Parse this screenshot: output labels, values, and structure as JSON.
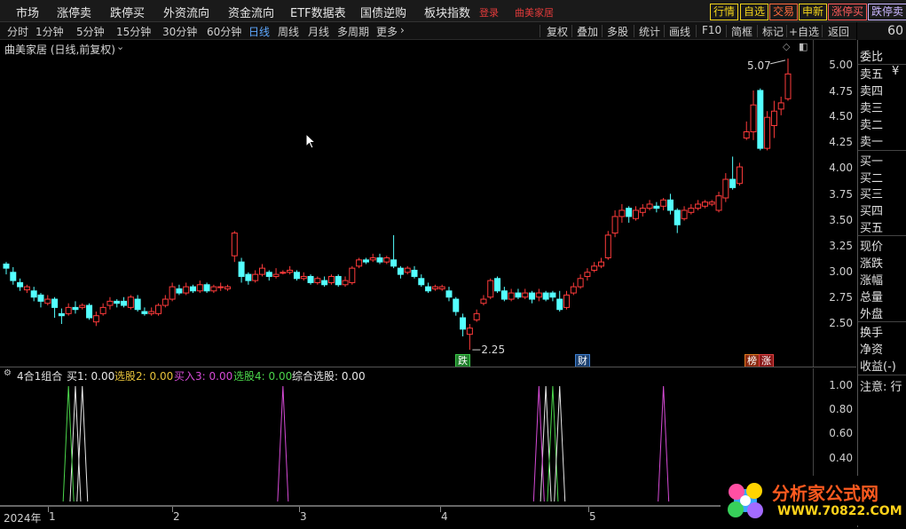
{
  "menu": {
    "items": [
      "市场",
      "涨停卖",
      "跌停买",
      "外资流向",
      "资金流向",
      "ETF数据表",
      "国债逆购",
      "板块指数"
    ],
    "login": "登录",
    "brand": "曲美家居",
    "quick": [
      {
        "label": "行情",
        "color": "#f2d31a"
      },
      {
        "label": "自选",
        "color": "#f2d31a"
      },
      {
        "label": "交易",
        "color": "#ff6a3c"
      },
      {
        "label": "申新",
        "color": "#f2d31a"
      },
      {
        "label": "涨停买",
        "color": "#ff5b5b"
      },
      {
        "label": "跌停卖",
        "color": "#c9b6ff"
      }
    ]
  },
  "periods": [
    "分时",
    "1分钟",
    "5分钟",
    "15分钟",
    "30分钟",
    "60分钟",
    "日线",
    "周线",
    "月线",
    "多周期",
    "更多"
  ],
  "active_period": "日线",
  "tools": [
    "复权",
    "叠加",
    "多股",
    "统计",
    "画线",
    "F10",
    "简框",
    "标记",
    "+自选",
    "返回"
  ],
  "side_top": "60",
  "chart_title": "曲美家居 (日线,前复权)",
  "main_axis": [
    "5.00",
    "4.75",
    "4.50",
    "4.25",
    "4.00",
    "3.75",
    "3.50",
    "3.25",
    "3.00",
    "2.75",
    "2.50"
  ],
  "ind_axis": [
    "1.00",
    "0.80",
    "0.60",
    "0.40"
  ],
  "annotations": {
    "high": "5.07",
    "low": "2.25"
  },
  "tags": [
    {
      "text": "跌",
      "fg": "#fff",
      "bg": "#1f7d2a",
      "border": "#3ccb4a"
    },
    {
      "text": "财",
      "fg": "#fff",
      "bg": "#1b3f6e",
      "border": "#3d7fd1"
    },
    {
      "text": "榜",
      "fg": "#fff",
      "bg": "#8a2a10",
      "border": "#e07a20"
    },
    {
      "text": "涨",
      "fg": "#fff",
      "bg": "#8a1a1a",
      "border": "#e04040"
    }
  ],
  "indicator": {
    "name": "4合1组合",
    "items": [
      {
        "label": "买1: 0.00",
        "color": "#e8e8e8"
      },
      {
        "label": "选股2: 0.00",
        "color": "#e6c23a"
      },
      {
        "label": "买入3: 0.00",
        "color": "#d64bd6"
      },
      {
        "label": "选股4: 0.00",
        "color": "#4bd64b"
      },
      {
        "label": "综合选股: 0.00",
        "color": "#e8e8e8"
      }
    ]
  },
  "side_items": [
    "委比",
    "卖五",
    "卖四",
    "卖三",
    "卖二",
    "卖一",
    "买一",
    "买二",
    "买三",
    "买四",
    "买五",
    "现价",
    "涨跌",
    "涨幅",
    "总量",
    "外盘",
    "换手",
    "净资",
    "收益(-)",
    "注意: 行"
  ],
  "side_yen": "¥",
  "xaxis": {
    "year": "2024年",
    "months": [
      "1",
      "2",
      "3",
      "4",
      "5"
    ]
  },
  "watermark": {
    "title": "分析家公式网",
    "url": "WWW.70822.COM"
  },
  "colors": {
    "up": "#ff3b3b",
    "down": "#54ffff",
    "bg": "#000000",
    "accent": "#5ea8ff"
  },
  "chart_data": {
    "type": "candlestick",
    "y_range": [
      2.2,
      5.2
    ],
    "x_months": [
      "1",
      "2",
      "3",
      "4",
      "5"
    ],
    "candles": [
      [
        3.08,
        3.04,
        3.1,
        2.98
      ],
      [
        3.0,
        2.92,
        3.05,
        2.88
      ],
      [
        2.9,
        2.86,
        2.94,
        2.82
      ],
      [
        2.83,
        2.86,
        2.88,
        2.8
      ],
      [
        2.82,
        2.76,
        2.86,
        2.72
      ],
      [
        2.78,
        2.72,
        2.8,
        2.66
      ],
      [
        2.7,
        2.74,
        2.78,
        2.68
      ],
      [
        2.74,
        2.66,
        2.76,
        2.56
      ],
      [
        2.6,
        2.58,
        2.65,
        2.5
      ],
      [
        2.6,
        2.66,
        2.7,
        2.58
      ],
      [
        2.66,
        2.64,
        2.72,
        2.6
      ],
      [
        2.66,
        2.68,
        2.7,
        2.64
      ],
      [
        2.68,
        2.56,
        2.7,
        2.54
      ],
      [
        2.52,
        2.58,
        2.62,
        2.48
      ],
      [
        2.6,
        2.66,
        2.7,
        2.58
      ],
      [
        2.68,
        2.72,
        2.76,
        2.64
      ],
      [
        2.72,
        2.7,
        2.74,
        2.66
      ],
      [
        2.72,
        2.68,
        2.76,
        2.66
      ],
      [
        2.66,
        2.76,
        2.78,
        2.64
      ],
      [
        2.74,
        2.64,
        2.78,
        2.62
      ],
      [
        2.62,
        2.6,
        2.66,
        2.58
      ],
      [
        2.6,
        2.62,
        2.66,
        2.58
      ],
      [
        2.6,
        2.68,
        2.7,
        2.58
      ],
      [
        2.68,
        2.74,
        2.78,
        2.66
      ],
      [
        2.74,
        2.86,
        2.9,
        2.72
      ],
      [
        2.84,
        2.8,
        2.88,
        2.78
      ],
      [
        2.8,
        2.86,
        2.9,
        2.78
      ],
      [
        2.86,
        2.82,
        2.88,
        2.8
      ],
      [
        2.82,
        2.88,
        2.92,
        2.8
      ],
      [
        2.88,
        2.82,
        2.9,
        2.8
      ],
      [
        2.82,
        2.86,
        2.88,
        2.8
      ],
      [
        2.86,
        2.86,
        2.9,
        2.82
      ],
      [
        2.84,
        2.86,
        2.88,
        2.82
      ],
      [
        3.16,
        3.38,
        3.4,
        3.1
      ],
      [
        3.1,
        2.96,
        3.14,
        2.9
      ],
      [
        2.98,
        2.92,
        3.0,
        2.88
      ],
      [
        2.92,
        2.98,
        3.02,
        2.9
      ],
      [
        2.98,
        3.04,
        3.08,
        2.96
      ],
      [
        3.0,
        2.96,
        3.02,
        2.92
      ],
      [
        2.96,
        2.98,
        3.04,
        2.94
      ],
      [
        3.0,
        3.0,
        3.02,
        2.98
      ],
      [
        3.0,
        3.02,
        3.06,
        2.98
      ],
      [
        3.0,
        2.94,
        3.02,
        2.92
      ],
      [
        2.94,
        2.96,
        3.0,
        2.92
      ],
      [
        2.96,
        2.9,
        2.98,
        2.88
      ],
      [
        2.9,
        2.94,
        2.96,
        2.88
      ],
      [
        2.92,
        2.88,
        2.96,
        2.86
      ],
      [
        2.9,
        2.96,
        2.98,
        2.88
      ],
      [
        2.96,
        2.88,
        2.98,
        2.86
      ],
      [
        2.88,
        2.92,
        2.96,
        2.86
      ],
      [
        2.9,
        3.04,
        3.06,
        2.88
      ],
      [
        3.06,
        3.12,
        3.14,
        3.04
      ],
      [
        3.12,
        3.1,
        3.14,
        3.08
      ],
      [
        3.12,
        3.14,
        3.18,
        3.1
      ],
      [
        3.14,
        3.1,
        3.18,
        3.08
      ],
      [
        3.1,
        3.14,
        3.16,
        3.08
      ],
      [
        3.12,
        3.06,
        3.36,
        3.04
      ],
      [
        3.04,
        2.98,
        3.06,
        2.94
      ],
      [
        3.0,
        3.04,
        3.06,
        2.98
      ],
      [
        3.02,
        2.96,
        3.06,
        2.94
      ],
      [
        2.94,
        2.88,
        2.98,
        2.86
      ],
      [
        2.86,
        2.82,
        2.9,
        2.8
      ],
      [
        2.84,
        2.86,
        2.88,
        2.82
      ],
      [
        2.84,
        2.86,
        2.88,
        2.82
      ],
      [
        2.82,
        2.76,
        2.86,
        2.72
      ],
      [
        2.74,
        2.62,
        2.76,
        2.58
      ],
      [
        2.56,
        2.45,
        2.6,
        2.38
      ],
      [
        2.4,
        2.46,
        2.5,
        2.25
      ],
      [
        2.54,
        2.6,
        2.64,
        2.52
      ],
      [
        2.7,
        2.74,
        2.78,
        2.68
      ],
      [
        2.76,
        2.92,
        2.94,
        2.74
      ],
      [
        2.94,
        2.82,
        2.96,
        2.8
      ],
      [
        2.82,
        2.74,
        2.86,
        2.72
      ],
      [
        2.74,
        2.8,
        2.84,
        2.72
      ],
      [
        2.8,
        2.76,
        2.84,
        2.74
      ],
      [
        2.76,
        2.8,
        2.84,
        2.74
      ],
      [
        2.8,
        2.74,
        2.82,
        2.7
      ],
      [
        2.76,
        2.8,
        2.84,
        2.72
      ],
      [
        2.8,
        2.74,
        2.82,
        2.72
      ],
      [
        2.8,
        2.76,
        2.82,
        2.72
      ],
      [
        2.74,
        2.64,
        2.82,
        2.62
      ],
      [
        2.66,
        2.78,
        2.82,
        2.64
      ],
      [
        2.8,
        2.86,
        2.9,
        2.78
      ],
      [
        2.86,
        2.94,
        2.98,
        2.84
      ],
      [
        2.96,
        3.0,
        3.04,
        2.92
      ],
      [
        3.02,
        3.06,
        3.1,
        3.0
      ],
      [
        3.06,
        3.1,
        3.14,
        3.04
      ],
      [
        3.14,
        3.36,
        3.4,
        3.12
      ],
      [
        3.38,
        3.54,
        3.6,
        3.34
      ],
      [
        3.54,
        3.6,
        3.66,
        3.48
      ],
      [
        3.62,
        3.54,
        3.64,
        3.48
      ],
      [
        3.52,
        3.6,
        3.64,
        3.5
      ],
      [
        3.58,
        3.62,
        3.66,
        3.54
      ],
      [
        3.62,
        3.66,
        3.7,
        3.6
      ],
      [
        3.64,
        3.62,
        3.68,
        3.58
      ],
      [
        3.64,
        3.7,
        3.72,
        3.6
      ],
      [
        3.7,
        3.6,
        3.76,
        3.56
      ],
      [
        3.6,
        3.46,
        3.62,
        3.38
      ],
      [
        3.52,
        3.6,
        3.64,
        3.5
      ],
      [
        3.58,
        3.62,
        3.66,
        3.56
      ],
      [
        3.62,
        3.66,
        3.7,
        3.6
      ],
      [
        3.64,
        3.68,
        3.7,
        3.62
      ],
      [
        3.66,
        3.68,
        3.7,
        3.64
      ],
      [
        3.6,
        3.74,
        3.78,
        3.58
      ],
      [
        3.72,
        3.9,
        3.96,
        3.68
      ],
      [
        3.9,
        3.82,
        4.12,
        3.8
      ],
      [
        3.86,
        4.02,
        4.06,
        3.84
      ],
      [
        4.3,
        4.36,
        4.46,
        4.28
      ],
      [
        4.36,
        4.62,
        4.76,
        4.28
      ],
      [
        4.76,
        4.2,
        4.78,
        4.18
      ],
      [
        4.2,
        4.5,
        4.56,
        4.18
      ],
      [
        4.42,
        4.56,
        4.66,
        4.3
      ],
      [
        4.58,
        4.64,
        4.7,
        4.52
      ],
      [
        4.68,
        4.92,
        5.07,
        4.66
      ]
    ],
    "series": [
      {
        "name": "买1",
        "peaks": [
          10,
          78
        ]
      },
      {
        "name": "选股2",
        "peaks": []
      },
      {
        "name": "买入3",
        "peaks": [
          40,
          77,
          95
        ]
      },
      {
        "name": "选股4",
        "peaks": [
          9,
          79
        ]
      },
      {
        "name": "综合选股",
        "peaks": [
          11,
          80
        ]
      }
    ]
  }
}
